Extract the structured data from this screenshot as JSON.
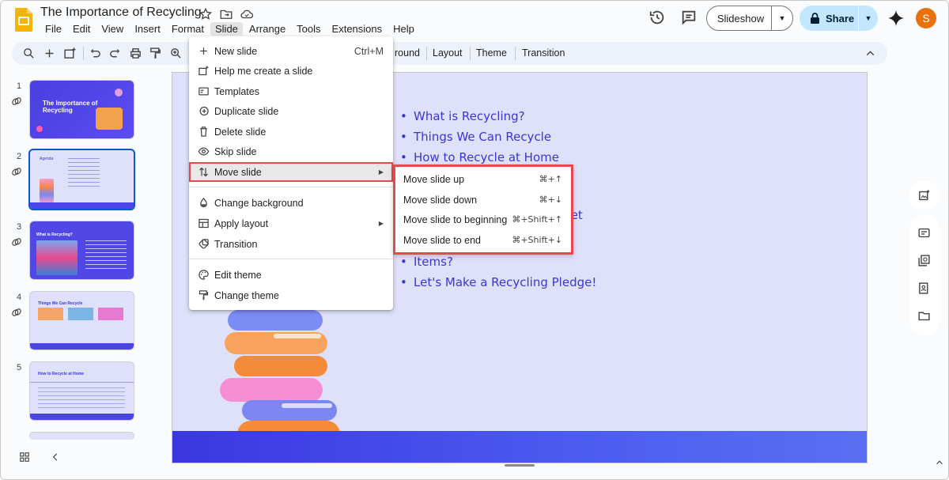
{
  "app": {
    "doc_title": "The Importance of Recycling",
    "brand_color": "#f4b400"
  },
  "menubar": [
    "File",
    "Edit",
    "View",
    "Insert",
    "Format",
    "Slide",
    "Arrange",
    "Tools",
    "Extensions",
    "Help"
  ],
  "header": {
    "slideshow_label": "Slideshow",
    "share_label": "Share",
    "avatar_letter": "S"
  },
  "toolbar": {
    "items": [
      "round",
      "Layout",
      "Theme",
      "Transition"
    ]
  },
  "filmstrip": {
    "numbers": [
      "1",
      "2",
      "3",
      "4",
      "5"
    ],
    "slides": [
      {
        "title": "The Importance of Recycling"
      },
      {
        "title": "Agenda"
      },
      {
        "title": "What is Recycling?"
      },
      {
        "title": "Things We Can Recycle"
      },
      {
        "title": "How to Recycle at Home"
      }
    ]
  },
  "slide": {
    "bullets": [
      "What is Recycling?",
      "Things We Can Recycle",
      "How to Recycle at Home",
      "anet",
      "Items?",
      "Let's Make a Recycling Pledge!"
    ]
  },
  "slide_menu": {
    "items": [
      {
        "label": "New slide",
        "shortcut": "Ctrl+M",
        "icon": "plus-icon"
      },
      {
        "label": "Help me create a slide",
        "icon": "sparkle-slide-icon"
      },
      {
        "label": "Templates",
        "icon": "templates-icon"
      },
      {
        "label": "Duplicate slide",
        "icon": "duplicate-icon"
      },
      {
        "label": "Delete slide",
        "icon": "trash-icon"
      },
      {
        "label": "Skip slide",
        "icon": "eye-icon"
      },
      {
        "label": "Move slide",
        "icon": "move-icon",
        "submenu": true
      },
      {
        "label": "Change background",
        "icon": "paint-drop-icon"
      },
      {
        "label": "Apply layout",
        "icon": "layout-icon",
        "submenu": true
      },
      {
        "label": "Transition",
        "icon": "transition-icon"
      },
      {
        "label": "Edit theme",
        "icon": "palette-icon"
      },
      {
        "label": "Change theme",
        "icon": "brush-icon"
      }
    ]
  },
  "move_submenu": {
    "items": [
      {
        "label": "Move slide up",
        "shortcut": "⌘+↑"
      },
      {
        "label": "Move slide down",
        "shortcut": "⌘+↓"
      },
      {
        "label": "Move slide to beginning",
        "shortcut": "⌘+Shift+↑"
      },
      {
        "label": "Move slide to end",
        "shortcut": "⌘+Shift+↓"
      }
    ]
  }
}
